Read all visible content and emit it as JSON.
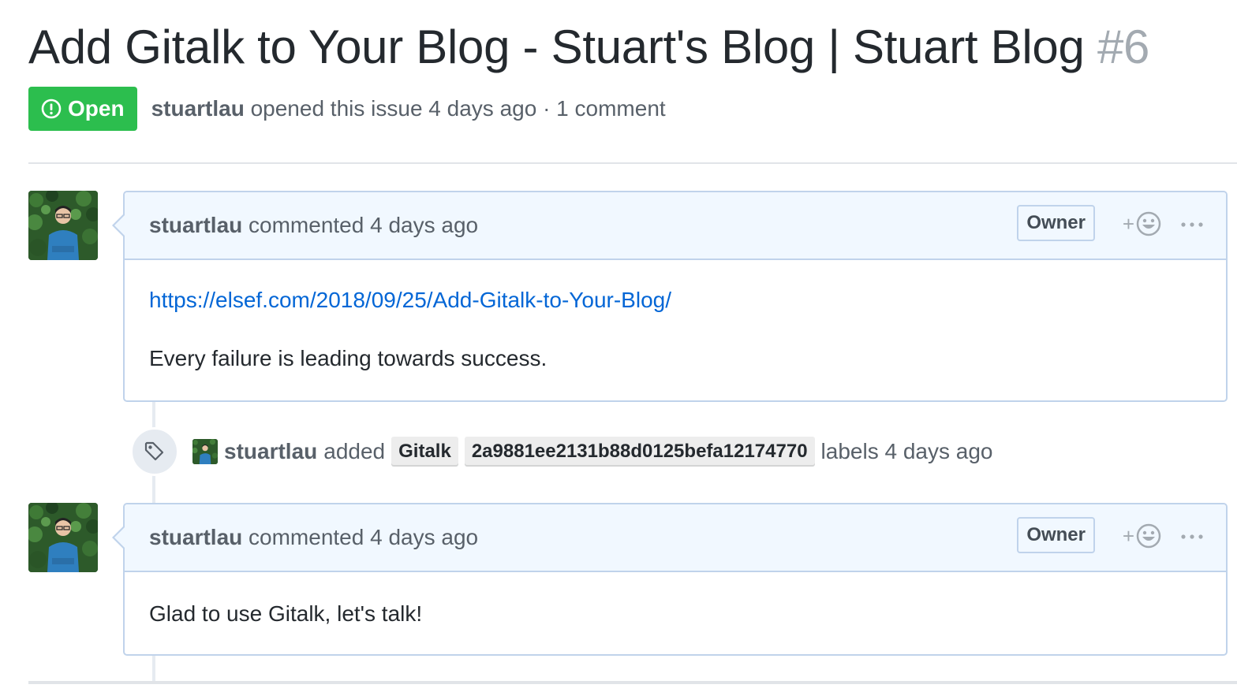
{
  "issue": {
    "title": "Add Gitalk to Your Blog - Stuart's Blog | Stuart Blog",
    "number": "#6",
    "state": "Open",
    "author": "stuartlau",
    "meta_text": "opened this issue 4 days ago · 1 comment"
  },
  "comments": [
    {
      "author": "stuartlau",
      "action": "commented 4 days ago",
      "role": "Owner",
      "link": "https://elsef.com/2018/09/25/Add-Gitalk-to-Your-Blog/",
      "text": "Every failure is leading towards success."
    },
    {
      "author": "stuartlau",
      "action": "commented 4 days ago",
      "role": "Owner",
      "text": "Glad to use Gitalk, let's talk!"
    }
  ],
  "label_event": {
    "actor": "stuartlau",
    "verb": "added",
    "labels": [
      "Gitalk",
      "2a9881ee2131b88d0125befa12174770"
    ],
    "suffix": "labels 4 days ago"
  },
  "reaction_plus": "+",
  "icons": {
    "state": "issue-opened-icon",
    "tag": "tag-icon",
    "reaction": "smiley-icon",
    "more": "kebab-horizontal-icon"
  },
  "colors": {
    "open_green": "#2cbe4e",
    "header_bg": "#f1f8ff",
    "header_border": "#c0d3eb",
    "link_blue": "#0366d6",
    "muted": "#586069",
    "number_gray": "#a3aab1"
  }
}
